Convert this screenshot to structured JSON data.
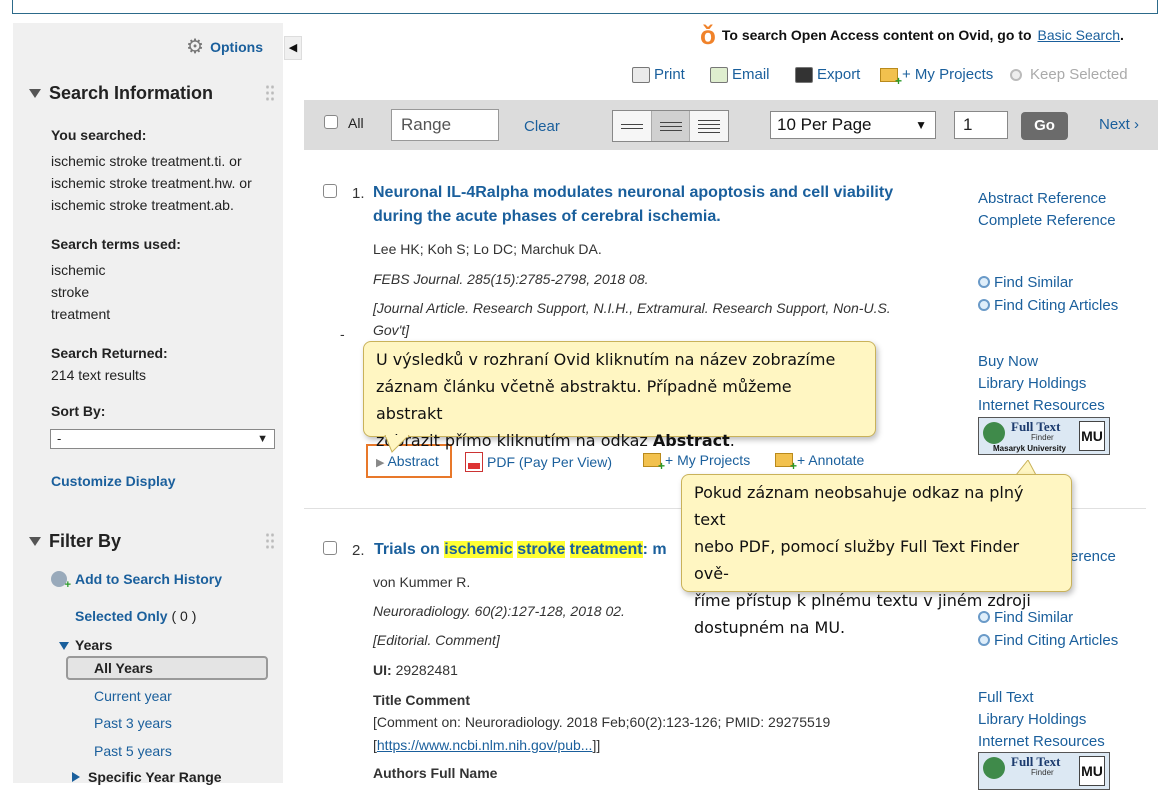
{
  "topbar": {
    "options_label": "Options",
    "oa_text": "To search Open Access content on Ovid, go to",
    "oa_link": "Basic Search",
    "oa_end": ".",
    "print": "Print",
    "email": "Email",
    "export": "Export",
    "my_projects": "+ My Projects",
    "keep_selected": "Keep Selected"
  },
  "sidebar": {
    "search_info_title": "Search Information",
    "you_searched_label": "You searched:",
    "you_searched": [
      "ischemic stroke treatment.ti. or",
      "ischemic stroke treatment.hw. or",
      "ischemic stroke treatment.ab."
    ],
    "terms_label": "Search terms used:",
    "terms": [
      "ischemic",
      "stroke",
      "treatment"
    ],
    "returned_label": "Search Returned:",
    "returned_value": "214 text results",
    "sort_label": "Sort By:",
    "sort_value": "-",
    "customize": "Customize Display",
    "filter_title": "Filter By",
    "add_history": "Add to Search History",
    "selected_only": "Selected Only",
    "selected_count": "( 0 )",
    "years_label": "Years",
    "year_options": [
      "All Years",
      "Current year",
      "Past 3 years",
      "Past 5 years"
    ],
    "specific_range": "Specific Year Range"
  },
  "toolbar": {
    "all_label": "All",
    "range_placeholder": "Range",
    "clear": "Clear",
    "per_page": "10 Per Page",
    "page_value": "1",
    "go": "Go",
    "next": "Next ›"
  },
  "records": [
    {
      "num": "1.",
      "title_l1": "Neuronal IL-4Ralpha modulates neuronal apoptosis and cell viability",
      "title_l2": "during the acute phases of cerebral ischemia.",
      "authors": "Lee HK; Koh S; Lo DC; Marchuk DA.",
      "source": "FEBS Journal. 285(15):2785-2798, 2018 08.",
      "pubtype_l1": "[Journal Article. Research Support, N.I.H., Extramural. Research Support, Non-U.S.",
      "pubtype_l2": "Gov't]",
      "dash": "-",
      "abstract": "Abstract",
      "pdf": "PDF (Pay Per View)",
      "my_projects": "+ My Projects",
      "annotate": "+ Annotate",
      "right_links": [
        "Abstract Reference",
        "Complete Reference",
        "Find Similar",
        "Find Citing Articles",
        "Buy Now",
        "Library Holdings",
        "Internet Resources"
      ]
    },
    {
      "num": "2.",
      "title_prefix": "Trials on ",
      "hl1": "ischemic",
      "hl2": "stroke",
      "hl3": "treatment",
      "title_suffix": ": m",
      "authors": "von Kummer R.",
      "source": "Neuroradiology. 60(2):127-128, 2018 02.",
      "pubtype": "[Editorial. Comment]",
      "ui_label": "UI:",
      "ui_value": "29282481",
      "comment_label": "Title Comment",
      "comment_l1": "[Comment on: Neuroradiology. 2018 Feb;60(2):123-126; PMID: 29275519",
      "comment_link": "https://www.ncbi.nlm.nih.gov/pub...",
      "comment_end": "]",
      "authors_full_label": "Authors Full Name",
      "right_partial": "erence",
      "right_links": [
        "Find Similar",
        "Find Citing Articles",
        "Full Text",
        "Library Holdings",
        "Internet Resources"
      ]
    }
  ],
  "ftf_badge": {
    "line1": "Full Text",
    "line2": "Finder",
    "line3": "Masaryk University",
    "mark": "MU"
  },
  "callouts": {
    "c1_l1": "U výsledků v rozhraní Ovid kliknutím na název zobrazíme",
    "c1_l2": "záznam článku včetně abstraktu. Případně můžeme abstrakt",
    "c1_l3_pre": "zobrazit přímo kliknutím na odkaz ",
    "c1_l3_bold": "Abstract",
    "c1_l3_end": ".",
    "c2_l1": "Pokud záznam neobsahuje odkaz na plný text",
    "c2_l2": "nebo PDF, pomocí služby Full Text Finder ově-",
    "c2_l3": "říme přístup k plnému textu v jiném zdroji",
    "c2_l4": "dostupném na MU."
  },
  "colors": {
    "link": "#1a5f9c",
    "highlight": "#ffff33",
    "callout_bg": "#fff6c2",
    "abstract_border": "#e8782a"
  }
}
